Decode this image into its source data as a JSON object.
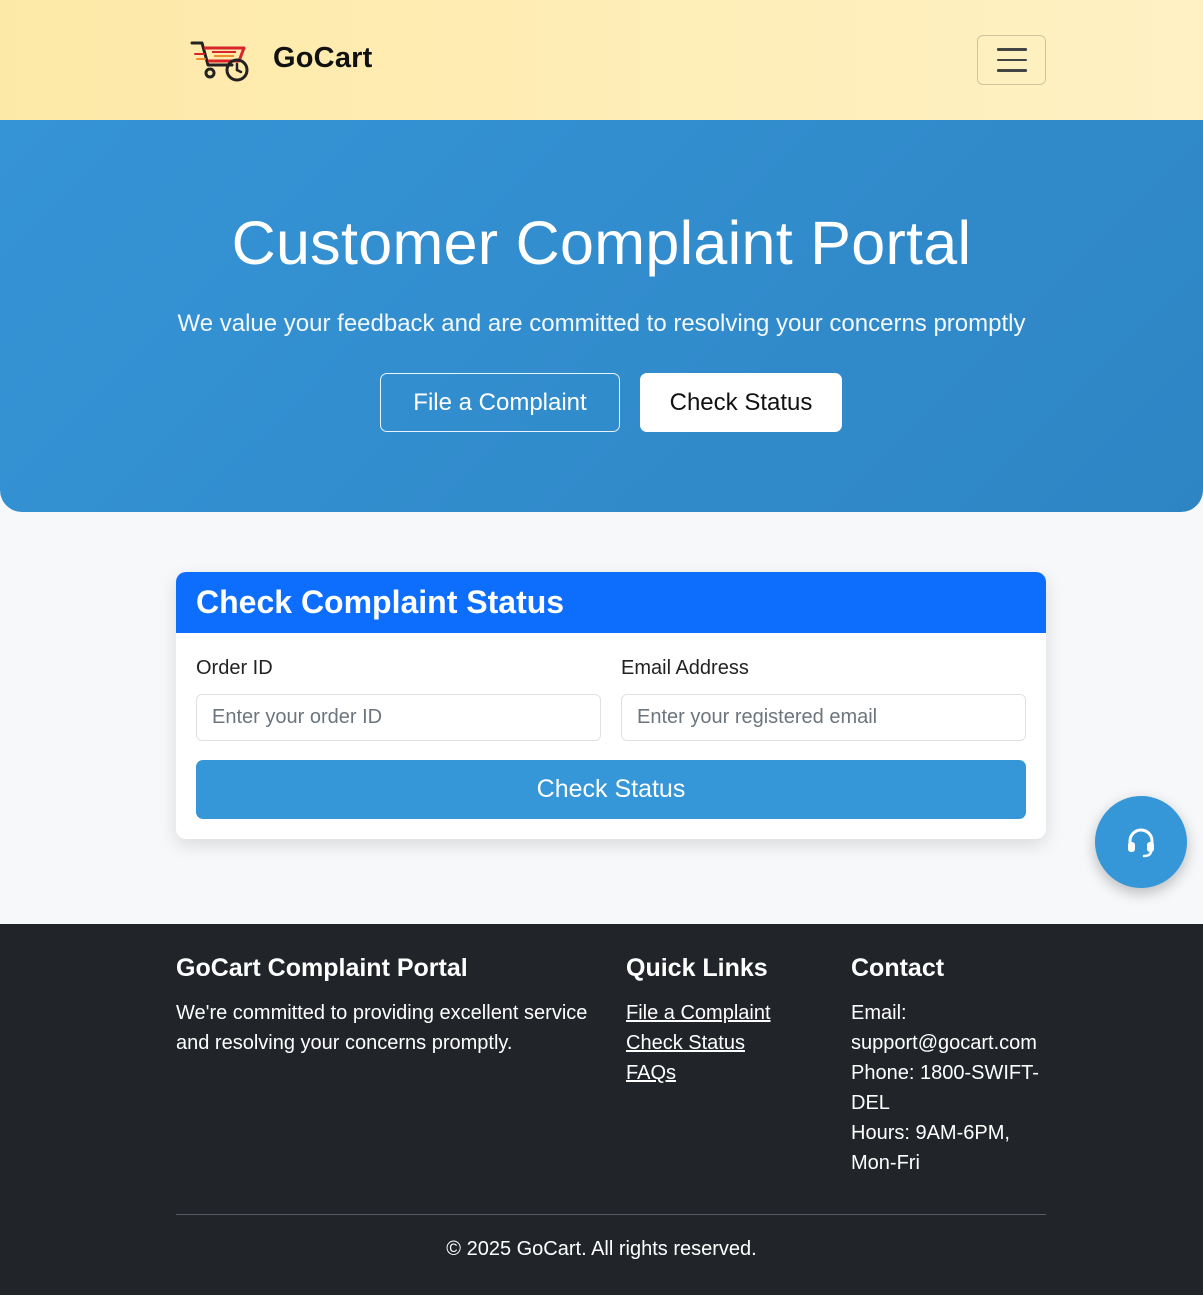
{
  "navbar": {
    "brand_name": "GoCart",
    "logo_icon": "delivery-cart-icon",
    "menu_icon": "hamburger-menu-icon"
  },
  "hero": {
    "title": "Customer Complaint Portal",
    "subtitle": "We value your feedback and are committed to resolving your concerns promptly",
    "file_button": "File a Complaint",
    "status_button": "Check Status"
  },
  "status_card": {
    "title": "Check Complaint Status",
    "order_label": "Order ID",
    "order_placeholder": "Enter your order ID",
    "email_label": "Email Address",
    "email_placeholder": "Enter your registered email",
    "submit_label": "Check Status"
  },
  "support_fab": {
    "icon": "headset-icon"
  },
  "footer": {
    "about": {
      "heading": "GoCart Complaint Portal",
      "text": "We're committed to providing excellent service and resolving your concerns promptly."
    },
    "links": {
      "heading": "Quick Links",
      "items": [
        "File a Complaint",
        "Check Status",
        "FAQs"
      ]
    },
    "contact": {
      "heading": "Contact",
      "email": "Email: support@gocart.com",
      "phone": "Phone: 1800-SWIFT-DEL",
      "hours": "Hours: 9AM-6PM, Mon-Fri"
    },
    "copyright": "© 2025 GoCart. All rights reserved."
  },
  "colors": {
    "hero_blue": "#3594d6",
    "card_header_blue": "#0d6efd",
    "button_blue": "#3596d8",
    "footer_dark": "#212529",
    "navbar_yellow": "#fde9a7"
  }
}
